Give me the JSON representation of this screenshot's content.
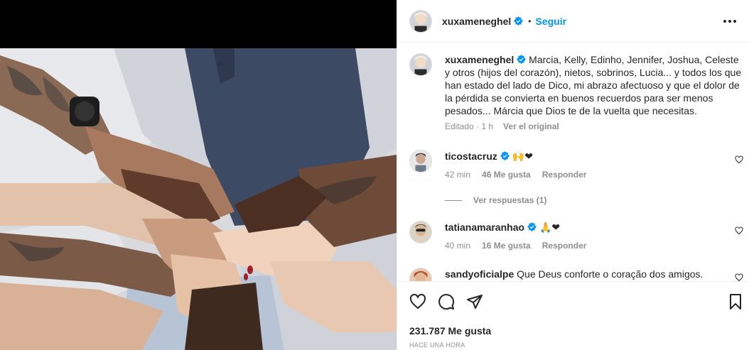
{
  "post": {
    "username": "xuxameneghel",
    "follow_label": "Seguir",
    "separator": "•",
    "more_icon": "more-horizontal-icon"
  },
  "caption": {
    "username": "xuxameneghel",
    "text": "Marcia, Kelly, Edinho, Jennifer, Joshua, Celeste y otros (hijos del corazón), nietos, sobrinos, Lucia... y todos los que han estado del lado de Dico, mi abrazo afectuoso y que el dolor de la pérdida se convierta en buenos recuerdos para ser menos pesados... Márcia que Dios te de la vuelta que necesitas.",
    "edited": "Editado · 1 h",
    "see_original": "Ver el original"
  },
  "comments": [
    {
      "username": "ticostacruz",
      "text": "🙌❤",
      "time": "42 min",
      "likes": "46 Me gusta",
      "reply": "Responder",
      "verified": true
    },
    {
      "username": "tatianamaranhao",
      "text": "🙏❤",
      "time": "40 min",
      "likes": "16 Me gusta",
      "reply": "Responder",
      "verified": true
    },
    {
      "username": "sandyoficialpe",
      "text": "Que Deus conforte o coração dos amigos.",
      "verified": false
    }
  ],
  "view_replies": "Ver respuestas (1)",
  "footer": {
    "likes": "231.787 Me gusta",
    "time": "HACE UNA HORA"
  },
  "colors": {
    "accent": "#0095f6",
    "heart": "#ed4956",
    "muted": "#8e8e8e"
  }
}
